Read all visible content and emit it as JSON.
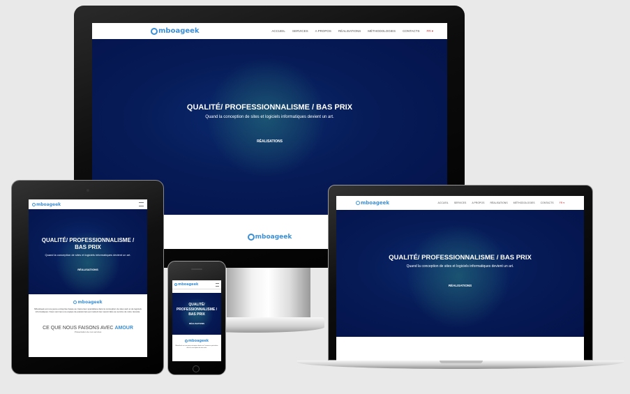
{
  "site": {
    "logo": "mboageek",
    "logo_initial": "G",
    "menu": [
      "ACCUEIL",
      "SERVICES",
      "A PROPOS",
      "RÉALISATIONS",
      "MÉTHODOLOGIES",
      "CONTACTS"
    ],
    "lang": "FR ▾",
    "hero_title": "QUALITÉ/ PROFESSIONNALISME / BAS PRIX",
    "hero_sub": "Quand la conception de sites et logiciels informatiques devient un art.",
    "cta": "RÉALISATIONS",
    "section_title_a": "CE QUE NOUS FAISONS AVEC",
    "section_title_b": "AMOUR",
    "section_sub": "Présentation de nos services",
    "about_text": "MboaGeek est une jeune entreprise basée au Cameroun spécialisée dans la conception de sites web et de logiciels informatiques. Nous sommes une équipe de passionnés qui mettent leur savoir-faire au service de votre réussite.",
    "phone_text": "MboaGeek est une jeune entreprise basée au Cameroun spécialisée dans la conception de sites web."
  },
  "colors": {
    "accent": "#3b8fd6",
    "hero": "#061b57",
    "bezel": "#111111"
  }
}
